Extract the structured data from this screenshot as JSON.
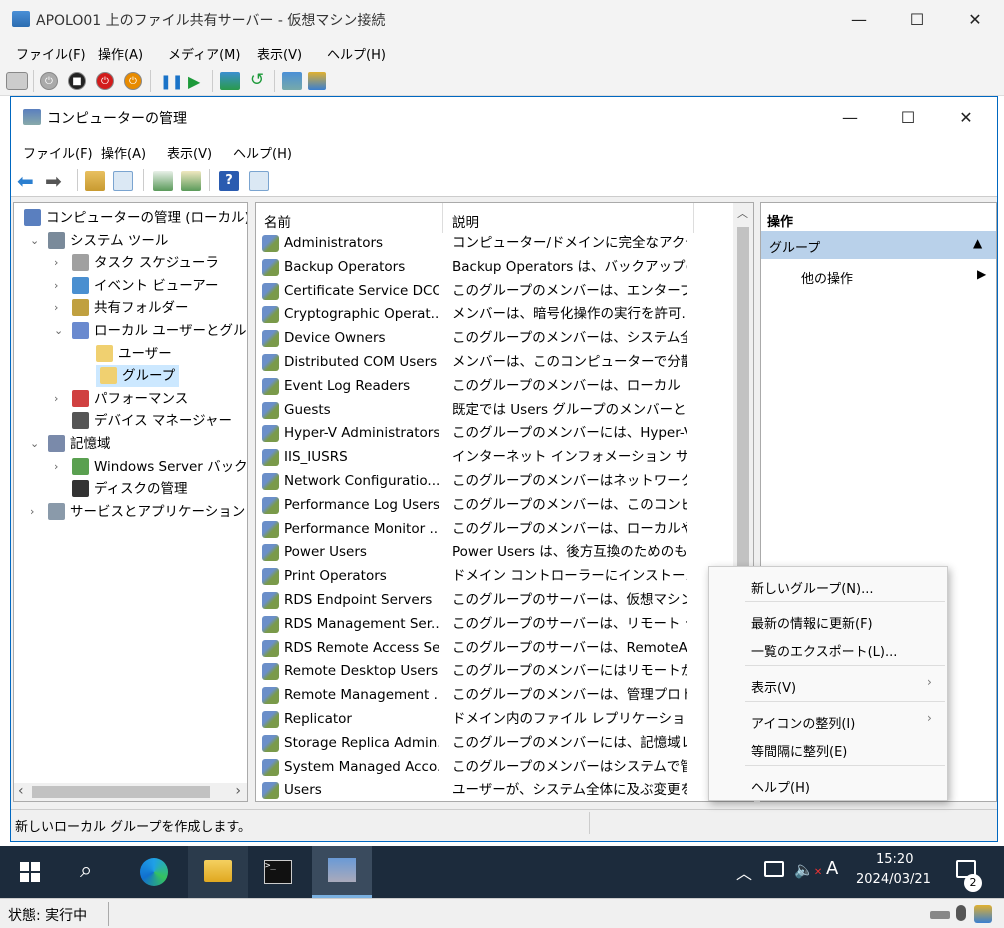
{
  "hyperv": {
    "title": "APOLO01 上のファイル共有サーバー - 仮想マシン接続",
    "menu": [
      "ファイル(F)",
      "操作(A)",
      "メディア(M)",
      "表示(V)",
      "ヘルプ(H)"
    ]
  },
  "mmc": {
    "title": "コンピューターの管理",
    "menu": [
      "ファイル(F)",
      "操作(A)",
      "表示(V)",
      "ヘルプ(H)"
    ]
  },
  "tree": [
    {
      "label": "コンピューターの管理 (ローカル)",
      "level": 0,
      "exp": ""
    },
    {
      "label": "システム ツール",
      "level": 1,
      "exp": "⌄"
    },
    {
      "label": "タスク スケジューラ",
      "level": 2,
      "exp": "›"
    },
    {
      "label": "イベント ビューアー",
      "level": 2,
      "exp": "›"
    },
    {
      "label": "共有フォルダー",
      "level": 2,
      "exp": "›"
    },
    {
      "label": "ローカル ユーザーとグループ",
      "level": 2,
      "exp": "⌄"
    },
    {
      "label": "ユーザー",
      "level": 3,
      "exp": ""
    },
    {
      "label": "グループ",
      "level": 3,
      "exp": ""
    },
    {
      "label": "パフォーマンス",
      "level": 2,
      "exp": "›"
    },
    {
      "label": "デバイス マネージャー",
      "level": 2,
      "exp": ""
    },
    {
      "label": "記憶域",
      "level": 1,
      "exp": "⌄"
    },
    {
      "label": "Windows Server バックアップ",
      "level": 2,
      "exp": "›"
    },
    {
      "label": "ディスクの管理",
      "level": 2,
      "exp": ""
    },
    {
      "label": "サービスとアプリケーション",
      "level": 1,
      "exp": "›"
    }
  ],
  "list": {
    "col_name": "名前",
    "col_desc": "説明",
    "rows": [
      [
        "Administrators",
        "コンピューター/ドメインに完全なアクセス..."
      ],
      [
        "Backup Operators",
        "Backup Operators は、バックアップの..."
      ],
      [
        "Certificate Service DCO...",
        "このグループのメンバーは、エンタープライ..."
      ],
      [
        "Cryptographic Operat...",
        "メンバーは、暗号化操作の実行を許可..."
      ],
      [
        "Device Owners",
        "このグループのメンバーは、システム全体..."
      ],
      [
        "Distributed COM Users",
        "メンバーは、このコンピューターで分散 CO..."
      ],
      [
        "Event Log Readers",
        "このグループのメンバーは、ローカル コンピ..."
      ],
      [
        "Guests",
        "既定では Users グループのメンバーと同..."
      ],
      [
        "Hyper-V Administrators",
        "このグループのメンバーには、Hyper-V の..."
      ],
      [
        "IIS_IUSRS",
        "インターネット インフォメーション サービスで..."
      ],
      [
        "Network Configuratio...",
        "このグループのメンバーはネットワーク機能..."
      ],
      [
        "Performance Log Users",
        "このグループのメンバーは、このコンピュータ..."
      ],
      [
        "Performance Monitor ...",
        "このグループのメンバーは、ローカルやリモ..."
      ],
      [
        "Power Users",
        "Power Users は、後方互換のためのも..."
      ],
      [
        "Print Operators",
        "ドメイン コントローラーにインストールされて..."
      ],
      [
        "RDS Endpoint Servers",
        "このグループのサーバーは、仮想マシンを..."
      ],
      [
        "RDS Management Ser...",
        "このグループのサーバーは、リモート デスク..."
      ],
      [
        "RDS Remote Access Se...",
        "このグループのサーバーは、RemoteApp ..."
      ],
      [
        "Remote Desktop Users",
        "このグループのメンバーにはリモートからロ..."
      ],
      [
        "Remote Management ...",
        "このグループのメンバーは、管理プロトコル..."
      ],
      [
        "Replicator",
        "ドメイン内のファイル レプリケーションをサ..."
      ],
      [
        "Storage Replica Admin...",
        "このグループのメンバーには、記憶域レプ..."
      ],
      [
        "System Managed Acco...",
        "このグループのメンバーはシステムで管理..."
      ],
      [
        "Users",
        "ユーザーが、システム全体に及ぶ変更を..."
      ]
    ]
  },
  "ops": {
    "header": "操作",
    "group": "グループ",
    "other": "他の操作"
  },
  "ctx": {
    "new_group": "新しいグループ(N)...",
    "refresh": "最新の情報に更新(F)",
    "export": "一覧のエクスポート(L)...",
    "view": "表示(V)",
    "arrange": "アイコンの整列(I)",
    "line_up": "等間隔に整列(E)",
    "help": "ヘルプ(H)"
  },
  "status_text": "新しいローカル グループを作成します。",
  "clock": {
    "time": "15:20",
    "date": "2024/03/21"
  },
  "notif_count": "2",
  "ime": "A",
  "vm_state": "状態: 実行中"
}
